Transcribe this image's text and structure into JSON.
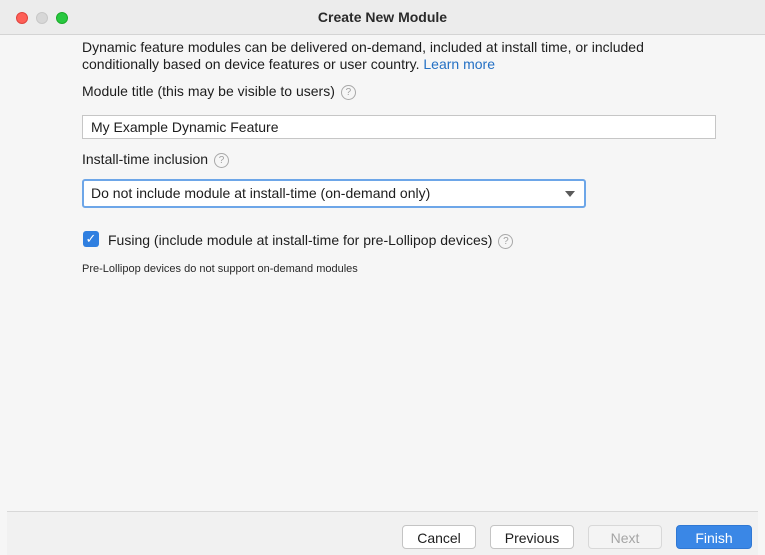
{
  "window": {
    "title": "Create New Module"
  },
  "intro": {
    "text": "Dynamic feature modules can be delivered on-demand, included at install time, or included conditionally based on device features or user country.",
    "link_label": "Learn more"
  },
  "module_title": {
    "label": "Module title (this may be visible to users)",
    "value": "My Example Dynamic Feature"
  },
  "install_time": {
    "label": "Install-time inclusion",
    "selected": "Do not include module at install-time (on-demand only)"
  },
  "fusing": {
    "checked": true,
    "label": "Fusing (include module at install-time for pre-Lollipop devices)",
    "note": "Pre-Lollipop devices do not support on-demand modules"
  },
  "help_glyph": "?",
  "check_glyph": "✓",
  "buttons": {
    "cancel": "Cancel",
    "previous": "Previous",
    "next": "Next",
    "finish": "Finish"
  },
  "colors": {
    "accent": "#3a87e6",
    "link": "#2470c4",
    "close": "#fe5f57",
    "maximize": "#28c840"
  }
}
